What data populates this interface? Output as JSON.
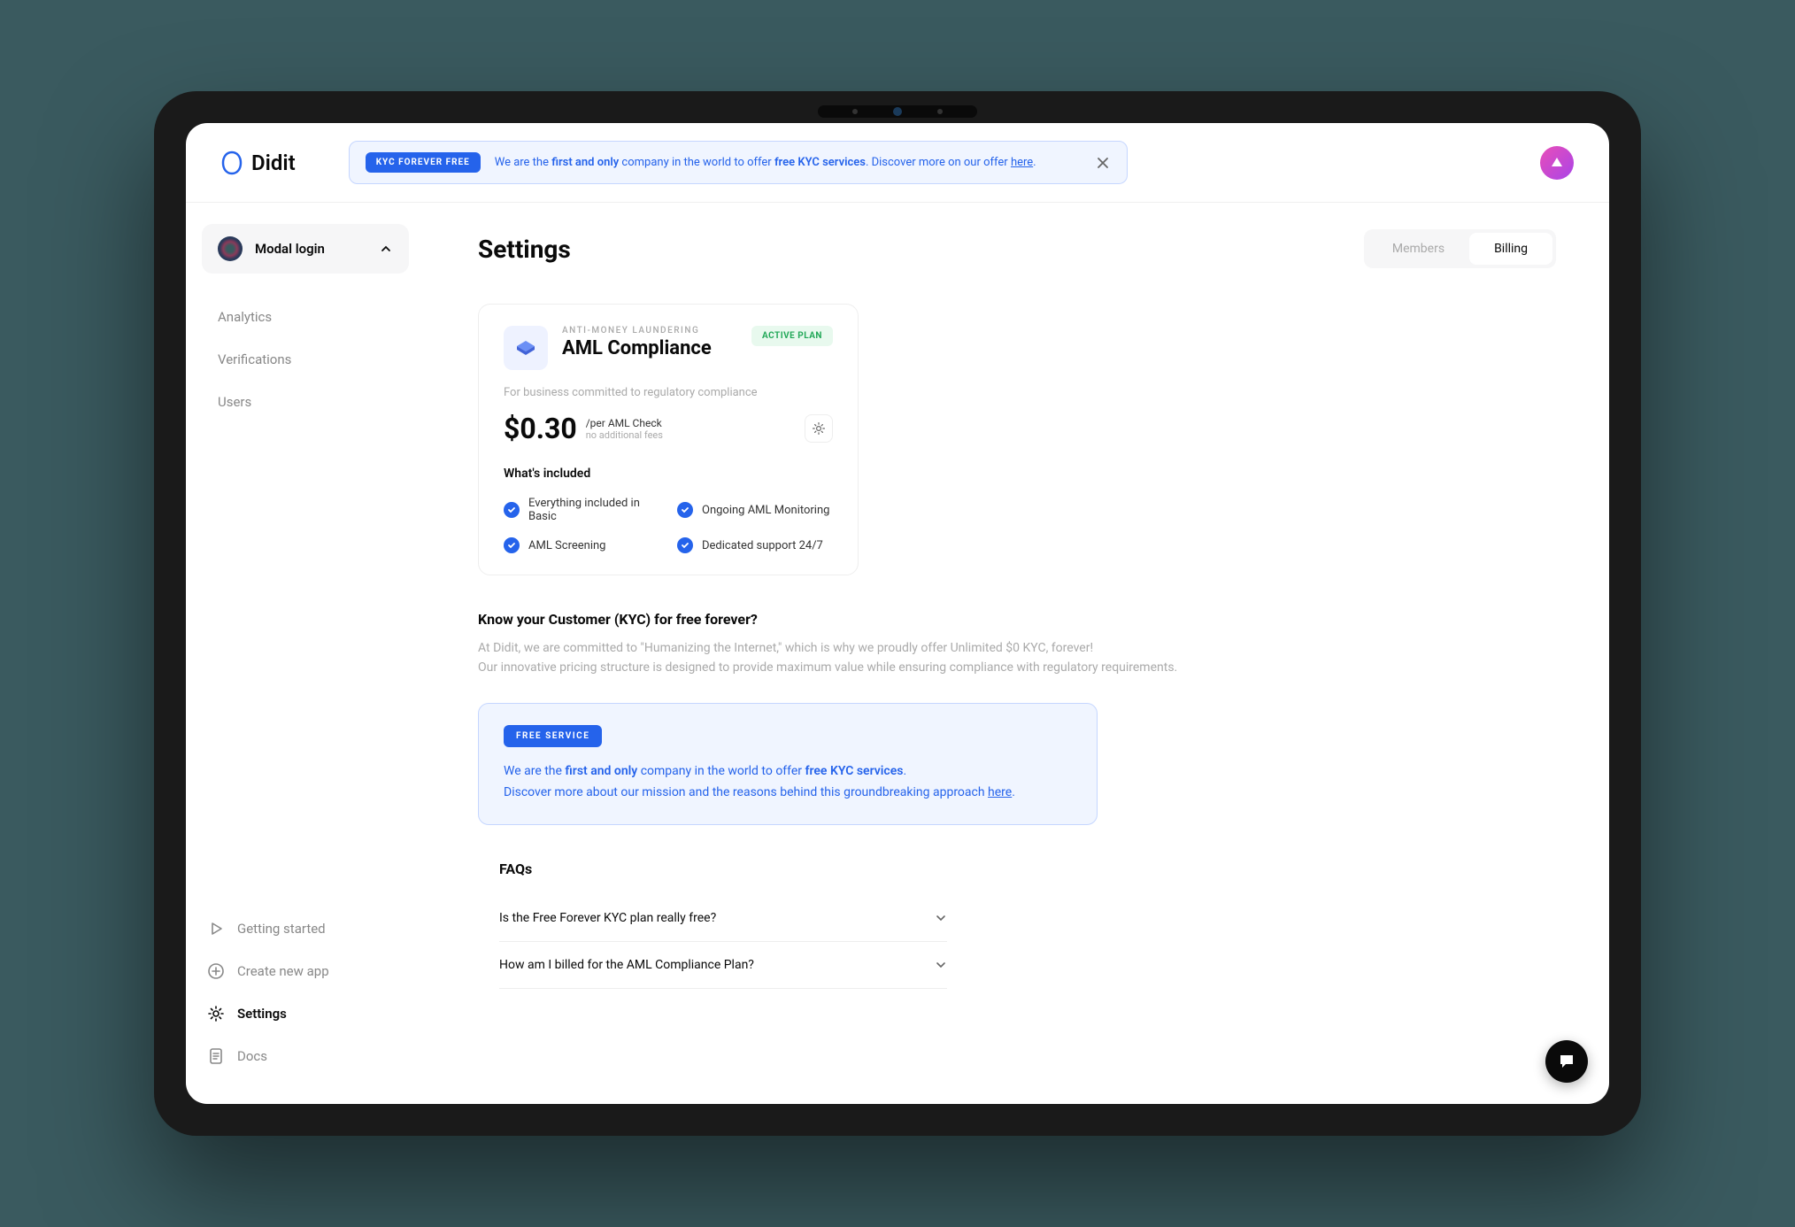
{
  "brand": "Didit",
  "topBanner": {
    "badge": "KYC FOREVER FREE",
    "pre": "We are the ",
    "bold1": "first and only",
    "mid": " company in the world to offer ",
    "bold2": "free KYC services",
    "post": ". Discover more on our offer ",
    "link": "here"
  },
  "workspace": {
    "name": "Modal login"
  },
  "nav": {
    "items": [
      "Analytics",
      "Verifications",
      "Users"
    ]
  },
  "bottomNav": {
    "gettingStarted": "Getting started",
    "createApp": "Create new app",
    "settings": "Settings",
    "docs": "Docs"
  },
  "page": {
    "title": "Settings",
    "tabs": {
      "members": "Members",
      "billing": "Billing"
    }
  },
  "plan": {
    "eyebrow": "ANTI-MONEY LAUNDERING",
    "name": "AML Compliance",
    "badge": "ACTIVE PLAN",
    "desc": "For business committed to regulatory compliance",
    "price": "$0.30",
    "priceUnit": "/per AML Check",
    "priceNote": "no additional fees",
    "includedTitle": "What's included",
    "features": [
      "Everything included in Basic",
      "Ongoing AML Monitoring",
      "AML Screening",
      "Dedicated support 24/7"
    ]
  },
  "kyc": {
    "title": "Know your Customer (KYC) for free forever?",
    "p1": "At Didit, we are committed to \"Humanizing the Internet,\" which is why we proudly offer Unlimited $0 KYC, forever!",
    "p2": "Our innovative pricing structure is designed to provide maximum value while ensuring compliance with regulatory requirements."
  },
  "freeBanner": {
    "badge": "FREE SERVICE",
    "line1a": "We are the ",
    "line1b": "first and only",
    "line1c": " company in the world to offer ",
    "line1d": "free KYC services",
    "line1e": ".",
    "line2a": "Discover more about our mission and the reasons behind this groundbreaking approach ",
    "line2Link": "here",
    "line2b": "."
  },
  "faq": {
    "title": "FAQs",
    "items": [
      "Is the Free Forever KYC plan really free?",
      "How am I billed for the AML Compliance Plan?"
    ]
  }
}
